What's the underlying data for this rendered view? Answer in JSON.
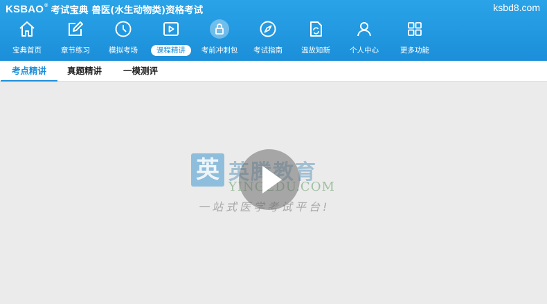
{
  "header": {
    "logo": "KSBAO",
    "logo_reg": "®",
    "title": "考试宝典 兽医(水生动物类)资格考试",
    "site": "ksbd8.com"
  },
  "nav": [
    {
      "label": "宝典首页",
      "icon": "home-icon"
    },
    {
      "label": "章节练习",
      "icon": "edit-icon"
    },
    {
      "label": "模拟考场",
      "icon": "clock-icon"
    },
    {
      "label": "课程精讲",
      "icon": "video-icon",
      "active": true
    },
    {
      "label": "考前冲刺包",
      "icon": "lock-icon",
      "locked": true
    },
    {
      "label": "考试指南",
      "icon": "compass-icon"
    },
    {
      "label": "温故知新",
      "icon": "refresh-doc-icon"
    },
    {
      "label": "个人中心",
      "icon": "user-icon"
    },
    {
      "label": "更多功能",
      "icon": "grid-icon"
    }
  ],
  "tabs": [
    {
      "label": "考点精讲",
      "active": true
    },
    {
      "label": "真题精讲"
    },
    {
      "label": "一模测评"
    }
  ],
  "watermark": {
    "box_char": "英",
    "cn": "英腾教育",
    "en": "YINGEDU.COM",
    "slogan": "一站式医学考试平台!"
  },
  "colors": {
    "primary": "#1b8fd9",
    "background": "#ebebeb"
  }
}
